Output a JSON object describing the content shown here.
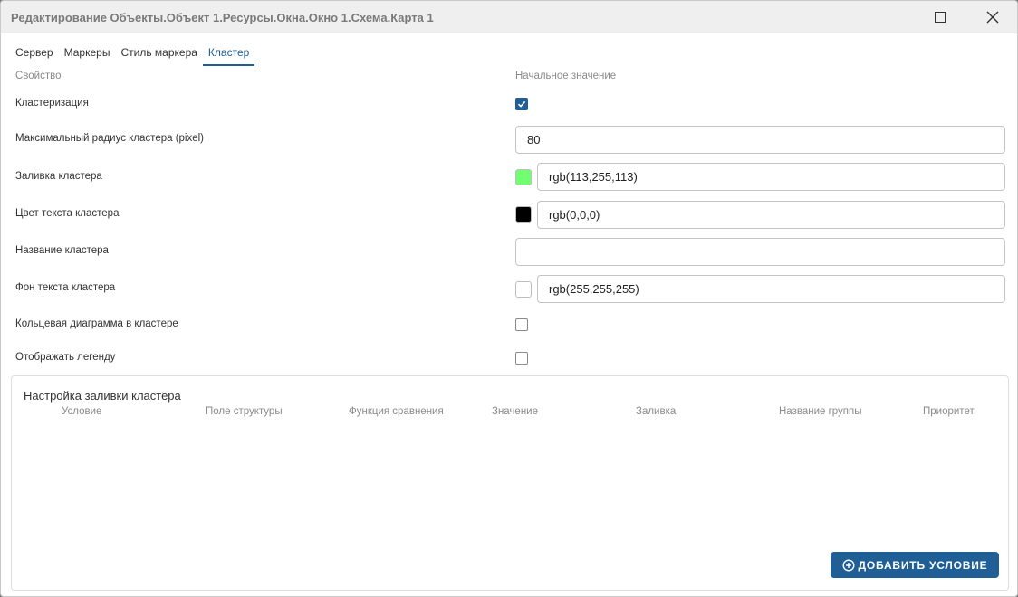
{
  "window": {
    "title": "Редактирование Объекты.Объект 1.Ресурсы.Окна.Окно 1.Схема.Карта 1",
    "maximize_icon": "maximize-icon",
    "close_icon": "close-icon"
  },
  "tabs": [
    {
      "label": "Сервер",
      "active": false
    },
    {
      "label": "Маркеры",
      "active": false
    },
    {
      "label": "Стиль маркера",
      "active": false
    },
    {
      "label": "Кластер",
      "active": true
    }
  ],
  "columns": {
    "property": "Свойство",
    "initial_value": "Начальное значение"
  },
  "properties": {
    "clustering": {
      "label": "Кластеризация",
      "checked": true
    },
    "max_radius": {
      "label": "Максимальный радиус кластера (pixel)",
      "value": "80"
    },
    "cluster_fill": {
      "label": "Заливка кластера",
      "value": "rgb(113,255,113)",
      "color": "#71ff71"
    },
    "cluster_text_color": {
      "label": "Цвет текста кластера",
      "value": "rgb(0,0,0)",
      "color": "#000000"
    },
    "cluster_name": {
      "label": "Название кластера",
      "value": ""
    },
    "cluster_text_bg": {
      "label": "Фон текста кластера",
      "value": "rgb(255,255,255)",
      "color": "#ffffff"
    },
    "donut_chart": {
      "label": "Кольцевая диаграмма в кластере",
      "checked": false
    },
    "show_legend": {
      "label": "Отображать легенду",
      "checked": false
    }
  },
  "fill_settings": {
    "title": "Настройка заливки кластера",
    "columns": [
      "Условие",
      "Поле структуры",
      "Функция сравнения",
      "Значение",
      "Заливка",
      "Название группы",
      "Приоритет"
    ],
    "add_button": "ДОБАВИТЬ УСЛОВИЕ",
    "add_icon": "plus-circle-icon"
  },
  "colors": {
    "accent": "#1f5f96"
  }
}
